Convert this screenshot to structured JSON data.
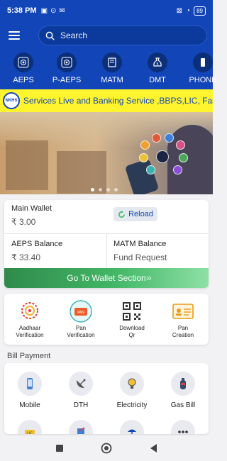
{
  "status": {
    "time": "5:38 PM",
    "battery": "89"
  },
  "search": {
    "placeholder": "Search"
  },
  "services": [
    {
      "label": "AEPS",
      "icon": "fingerprint-icon"
    },
    {
      "label": "P-AEPS",
      "icon": "fingerprint-icon"
    },
    {
      "label": "MATM",
      "icon": "atm-icon"
    },
    {
      "label": "DMT",
      "icon": "money-bag-icon"
    },
    {
      "label": "PHONE",
      "icon": "phone-icon"
    }
  ],
  "marquee": {
    "text": "Services Live and Banking Service ,BBPS,LIC, Fasta",
    "logo": "NKHS"
  },
  "wallet": {
    "main_label": "Main Wallet",
    "main_value": "₹ 3.00",
    "reload_label": "Reload",
    "aeps_label": "AEPS Balance",
    "aeps_value": "₹ 33.40",
    "matm_label": "MATM Balance",
    "matm_value": "Fund Request",
    "go_label": "Go To Wallet Section"
  },
  "verification": [
    {
      "label": "Aadhaar\nVerification",
      "icon": "aadhaar-icon"
    },
    {
      "label": "Pan\nVerification",
      "icon": "pan-card-icon"
    },
    {
      "label": "Download\nQr",
      "icon": "qr-code-icon"
    },
    {
      "label": "Pan\nCreation",
      "icon": "id-card-icon"
    }
  ],
  "bill_payment": {
    "title": "Bill Payment",
    "items": [
      {
        "label": "Mobile",
        "icon": "mobile-icon"
      },
      {
        "label": "DTH",
        "icon": "satellite-dish-icon"
      },
      {
        "label": "Electricity",
        "icon": "bulb-icon"
      },
      {
        "label": "Gas Bill",
        "icon": "gas-cylinder-icon"
      }
    ],
    "more_icons": [
      "lic-icon",
      "fastag-icon",
      "insurance-icon",
      "more-icon"
    ]
  },
  "colors": {
    "primary": "#1145b8",
    "marquee_bg": "#fff42e",
    "wallet_green": "#43b867"
  }
}
